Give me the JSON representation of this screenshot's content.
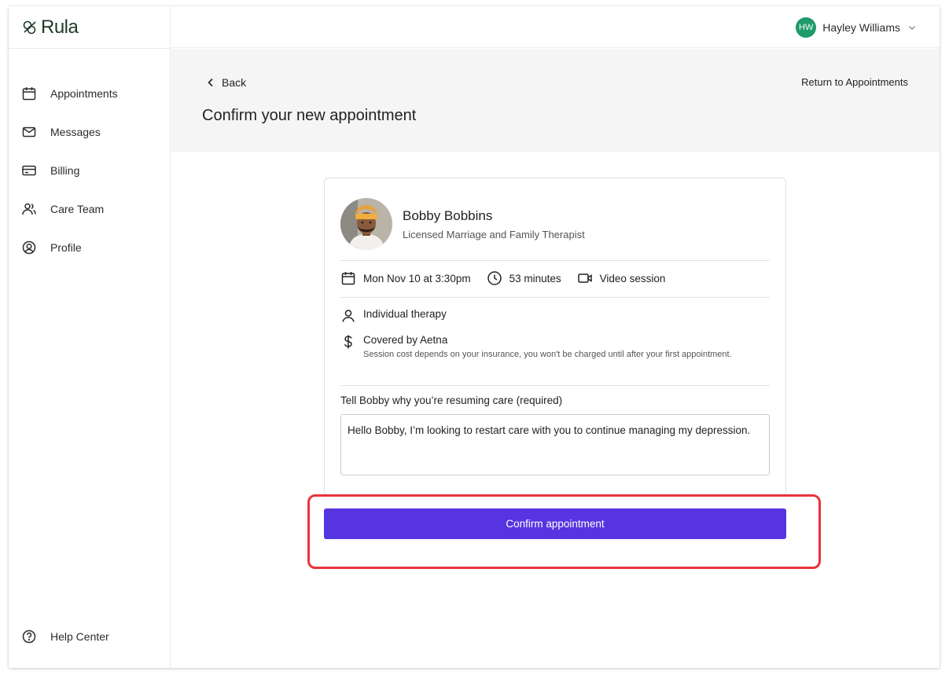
{
  "brand": {
    "logo_text": "Rula",
    "logo_color": "#1d3b2a"
  },
  "sidebar": {
    "items": [
      {
        "label": "Appointments",
        "icon": "calendar-icon"
      },
      {
        "label": "Messages",
        "icon": "mail-icon"
      },
      {
        "label": "Billing",
        "icon": "credit-card-icon"
      },
      {
        "label": "Care Team",
        "icon": "people-icon"
      },
      {
        "label": "Profile",
        "icon": "user-circle-icon"
      }
    ],
    "help_label": "Help Center"
  },
  "topbar": {
    "user_initials": "HW",
    "user_name": "Hayley Williams",
    "avatar_color": "#1f9a69"
  },
  "header": {
    "back_label": "Back",
    "return_label": "Return to Appointments",
    "title": "Confirm your new appointment"
  },
  "appointment": {
    "therapist_name": "Bobby Bobbins",
    "therapist_role": "Licensed Marriage and Family Therapist",
    "date_time": "Mon Nov 10 at 3:30pm",
    "duration": "53 minutes",
    "session_type": "Video session",
    "therapy_type": "Individual therapy",
    "coverage": "Covered by Aetna",
    "coverage_note": "Session cost depends on your insurance, you won't be charged until after your first appointment.",
    "question_label": "Tell Bobby why you’re resuming care (required)",
    "message_value": "Hello Bobby, I’m looking to restart care with you to continue managing my depression."
  },
  "actions": {
    "confirm_label": "Confirm appointment",
    "accent_color": "#5635e0"
  },
  "annotation": {
    "highlight_color": "#e8343a"
  }
}
